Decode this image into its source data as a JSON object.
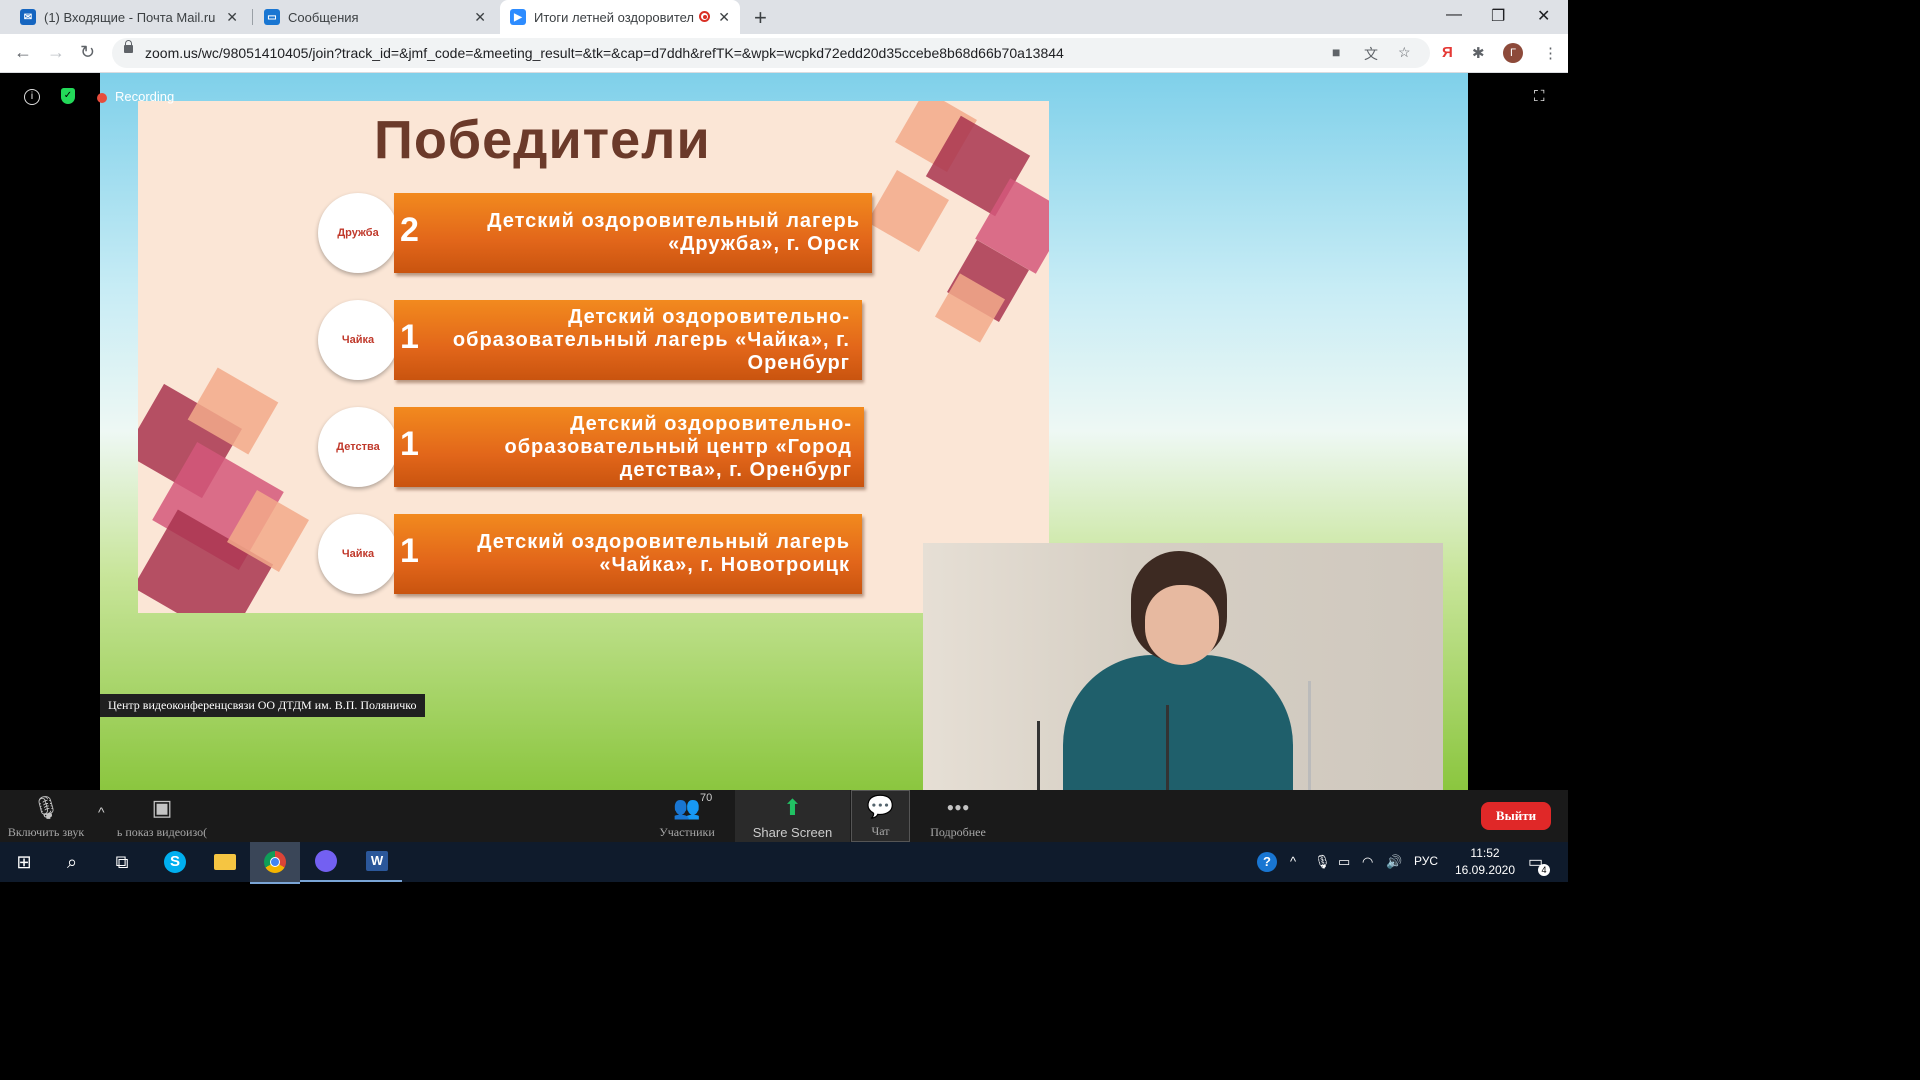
{
  "browser": {
    "tabs": [
      {
        "title": "(1) Входящие - Почта Mail.ru",
        "icon": "mail-icon",
        "color": "#1565c0"
      },
      {
        "title": "Сообщения",
        "icon": "chat-bubble-icon",
        "color": "#1976d2"
      },
      {
        "title": "Итоги летней оздоровител",
        "icon": "zoom-camera-icon",
        "color": "#2d8cff"
      }
    ],
    "url": "zoom.us/wc/98051410405/join?track_id=&jmf_code=&meeting_result=&tk=&cap=d7ddh&refTK=&wpk=wcpkd72edd20d35ccebe8b68d66b70a13844",
    "profile_initial": "Г",
    "yandex_label": "Я"
  },
  "zoom": {
    "recording_label": "Recording",
    "slide": {
      "title": "Победители",
      "entries": [
        {
          "place": "2",
          "text": "Детский оздоровительный лагерь\n«Дружба», г. Орск",
          "logo": "Дружба"
        },
        {
          "place": "1",
          "text": "Детский оздоровительно-\nобразовательный лагерь «Чайка», г.\nОренбург",
          "logo": "Чайка"
        },
        {
          "place": "1",
          "text": "Детский оздоровительно-\nобразовательный центр «Город\nдетства», г. Оренбург",
          "logo": "Детства"
        },
        {
          "place": "1",
          "text": "Детский оздоровительный лагерь\n«Чайка», г. Новотроицк",
          "logo": "Чайка"
        }
      ]
    },
    "caption": "Центр видеоконференцсвязи ОО ДТДМ им. В.П. Поляничко",
    "controls": {
      "unmute": "Включить звук",
      "video": "ь показ видеоизо(",
      "participants": "Участники",
      "participants_count": "70",
      "share": "Share Screen",
      "chat": "Чат",
      "more": "Подробнее",
      "leave": "Выйти"
    }
  },
  "taskbar": {
    "language": "РУС",
    "time": "11:52",
    "date": "16.09.2020",
    "notifications": "4"
  }
}
